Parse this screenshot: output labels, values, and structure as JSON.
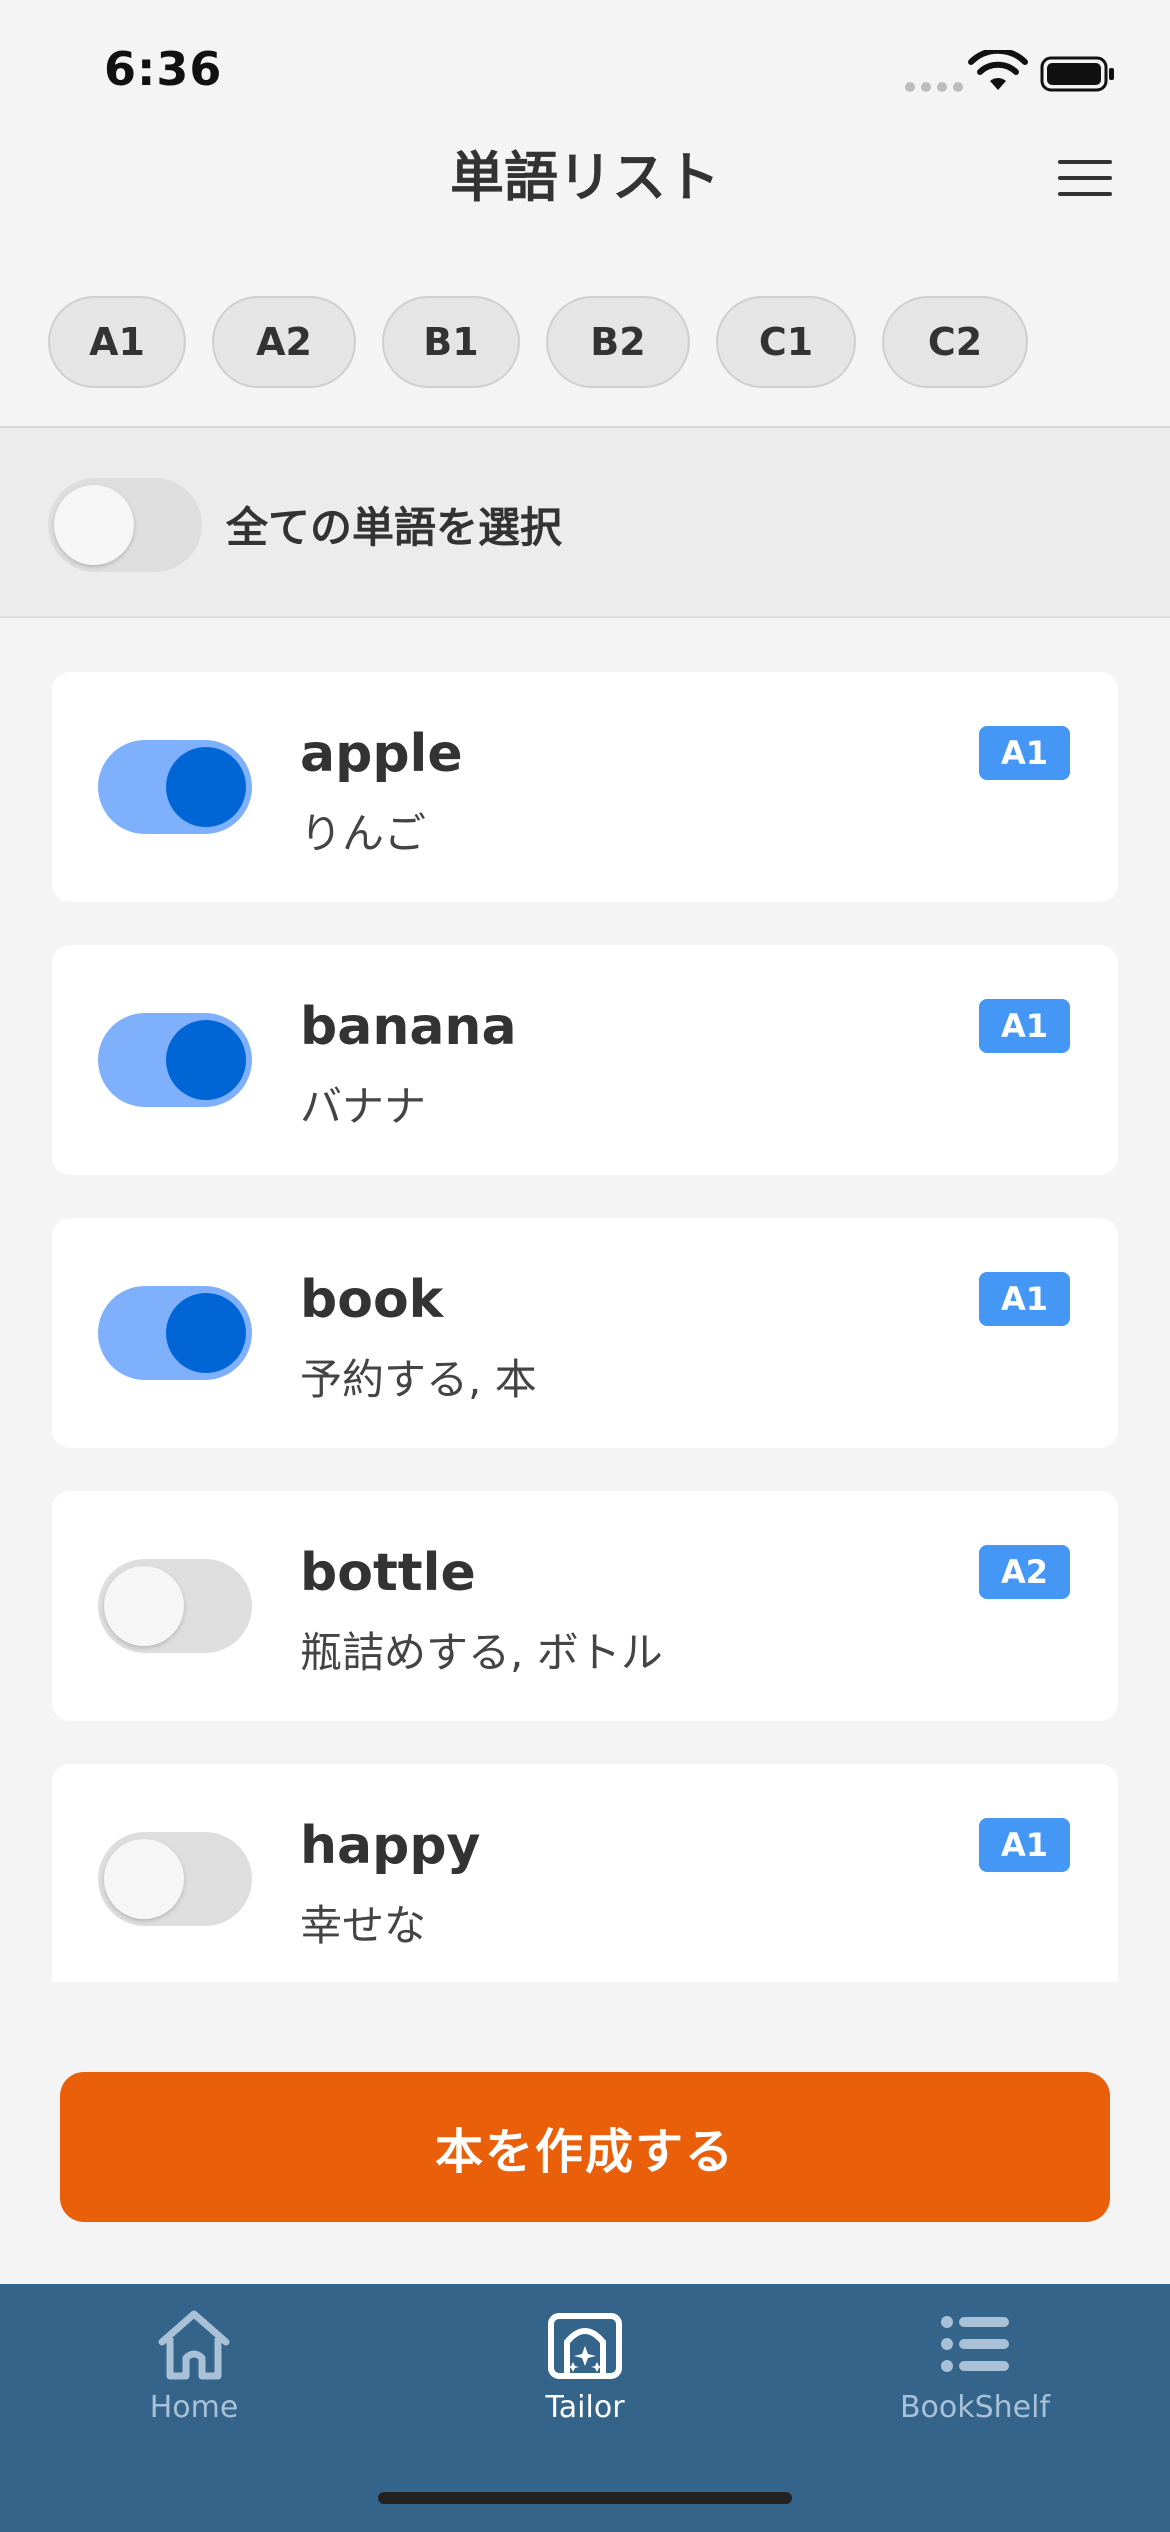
{
  "status_bar": {
    "time": "6:36"
  },
  "header": {
    "title": "単語リスト"
  },
  "level_filters": [
    "A1",
    "A2",
    "B1",
    "B2",
    "C1",
    "C2"
  ],
  "select_all": {
    "label": "全ての単語を選択",
    "checked": false
  },
  "words": [
    {
      "english": "apple",
      "japanese": "りんご",
      "level": "A1",
      "selected": true
    },
    {
      "english": "banana",
      "japanese": "バナナ",
      "level": "A1",
      "selected": true
    },
    {
      "english": "book",
      "japanese": "予約する, 本",
      "level": "A1",
      "selected": true
    },
    {
      "english": "bottle",
      "japanese": "瓶詰めする, ボトル",
      "level": "A2",
      "selected": false
    },
    {
      "english": "happy",
      "japanese": "幸せな",
      "level": "A1",
      "selected": false
    }
  ],
  "create_button": {
    "label": "本を作成する"
  },
  "tab_bar": {
    "items": [
      {
        "label": "Home",
        "icon": "home-icon",
        "active": false
      },
      {
        "label": "Tailor",
        "icon": "tailor-book-icon",
        "active": true
      },
      {
        "label": "BookShelf",
        "icon": "list-icon",
        "active": false
      }
    ]
  },
  "colors": {
    "accent_button": "#ea600a",
    "toggle_on_track": "#7eb0fb",
    "toggle_on_knob": "#0066d6",
    "badge": "#4597f5",
    "tab_bar": "#34648a"
  }
}
